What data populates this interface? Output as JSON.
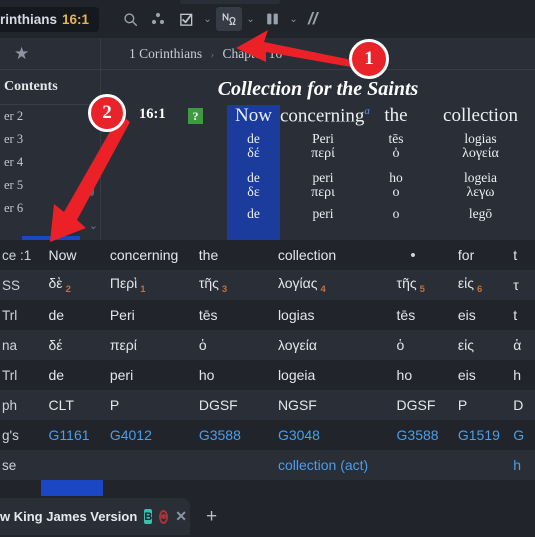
{
  "topbar": {
    "reference_text": "rinthians",
    "reference_verse": "16:1",
    "icons": [
      {
        "name": "search-icon",
        "glyph": "⌕"
      },
      {
        "name": "node-graph-icon",
        "glyph": "∴"
      },
      {
        "name": "checkbox-icon",
        "glyph": "☑"
      },
      {
        "name": "greek-omega-icon",
        "glyph": "ℵΩ"
      },
      {
        "name": "parallel-columns-icon",
        "glyph": "▐▌"
      },
      {
        "name": "double-slash-icon",
        "glyph": "//"
      }
    ],
    "caret": "⌄"
  },
  "breadcrumb": {
    "star": "★",
    "book": "1 Corinthians",
    "separator": "›",
    "chapter": "Chapter 16"
  },
  "sidebar": {
    "title": "Contents",
    "items": [
      "er 2",
      "er 3",
      "er 4",
      "er 5",
      "er 6"
    ],
    "chevron": "⌄"
  },
  "interlinear": {
    "heading": "Collection for the Saints",
    "verse_number": "16:1",
    "question_badge": "?",
    "footnote_marker": "a",
    "columns": [
      {
        "english": "Now",
        "translit_1": "de",
        "greek_1": "δέ",
        "translit_2": "de",
        "greek_2": "δε",
        "translit_3": "de",
        "highlight": true
      },
      {
        "english": "concerning",
        "translit_1": "Peri",
        "greek_1": "περί",
        "translit_2": "peri",
        "greek_2": "περι",
        "translit_3": "peri",
        "highlight": false
      },
      {
        "english": "the",
        "translit_1": "tēs",
        "greek_1": "ὁ",
        "translit_2": "ho",
        "greek_2": "ο",
        "translit_3": "o",
        "highlight": false
      },
      {
        "english": "collection",
        "translit_1": "logias",
        "greek_1": "λογεία",
        "translit_2": "logeia",
        "greek_2": "λεγω",
        "translit_3": "legō",
        "highlight": false
      }
    ]
  },
  "grid": {
    "row_labels": [
      "ce :1",
      "SS",
      "Trl",
      "na",
      "Trl",
      "ph",
      "g's",
      "se"
    ],
    "columns": [
      {
        "highlight": true,
        "cells": [
          "Now",
          "δὲ",
          "de",
          "δέ",
          "de",
          "CLT",
          "G1161",
          ""
        ],
        "num": "2"
      },
      {
        "highlight": false,
        "cells": [
          "concerning",
          "Περὶ",
          "Peri",
          "περί",
          "peri",
          "P",
          "G4012",
          ""
        ],
        "num": "1"
      },
      {
        "highlight": false,
        "cells": [
          "the",
          "τῆς",
          "tēs",
          "ὁ",
          "ho",
          "DGSF",
          "G3588",
          ""
        ],
        "num": "3"
      },
      {
        "highlight": false,
        "cells": [
          "collection",
          "λογίας",
          "logias",
          "λογεία",
          "logeia",
          "NGSF",
          "G3048",
          "collection (act)"
        ],
        "num": "4"
      },
      {
        "highlight": false,
        "cells": [
          "•",
          "τῆς",
          "tēs",
          "ὁ",
          "ho",
          "DGSF",
          "G3588",
          ""
        ],
        "num": "5"
      },
      {
        "highlight": false,
        "cells": [
          "for",
          "εἰς",
          "eis",
          "εἰς",
          "eis",
          "P",
          "G1519",
          ""
        ],
        "num": "6"
      },
      {
        "highlight": false,
        "cells": [
          "t",
          "τ",
          "t",
          "ἁ",
          "h",
          "D",
          "G",
          "h"
        ],
        "num": ""
      }
    ]
  },
  "tabbar": {
    "tab_title": "w King James Version",
    "badge": "B",
    "close": "✕",
    "add": "+"
  },
  "annotations": [
    {
      "label": "1"
    },
    {
      "label": "2"
    }
  ],
  "colors": {
    "accent_blue": "#1b47c4",
    "annotation_red": "#e8242a",
    "strong_link": "#4a9eea",
    "verse_ref": "#e8b54d",
    "badge_teal": "#3bbfae"
  }
}
